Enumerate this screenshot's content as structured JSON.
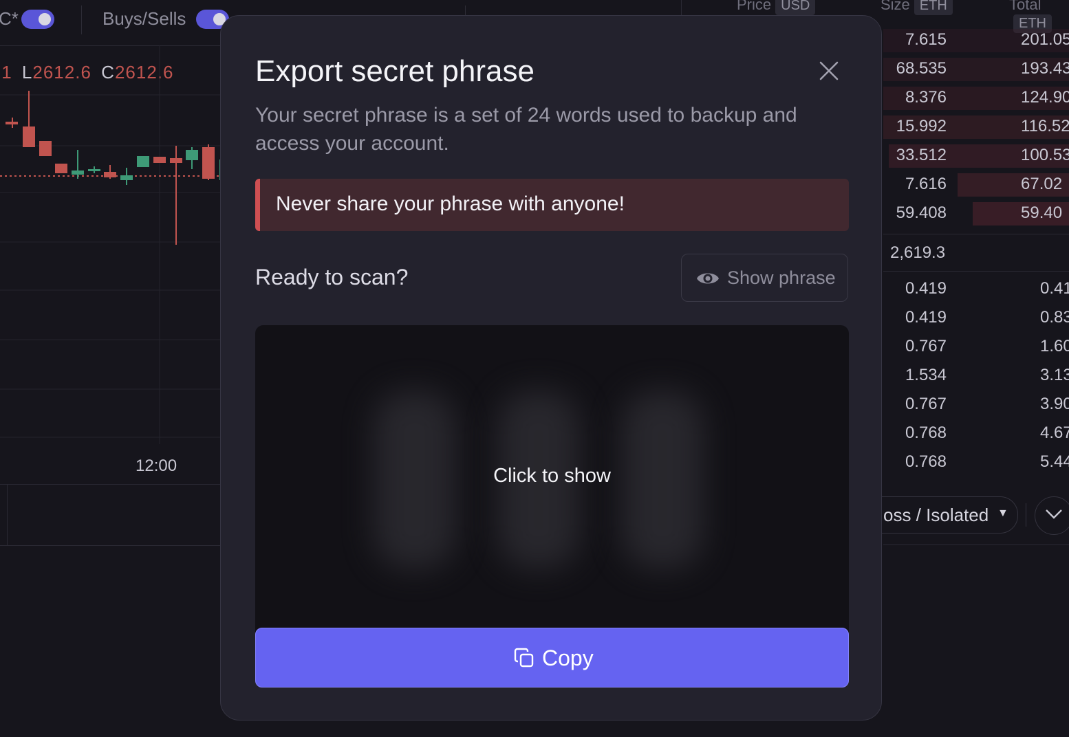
{
  "toolbar": {
    "toggle1_label": "C*",
    "toggle2_label": "Buys/Sells"
  },
  "ohlc": {
    "o_value": ".1",
    "l_key": "L",
    "l_value": "2612.6",
    "c_key": "C",
    "c_value": "2612.6"
  },
  "chart": {
    "time_label": "12:00"
  },
  "orderbook": {
    "price_header": "Price",
    "price_unit": "USD",
    "size_header": "Size",
    "size_unit": "ETH",
    "total_header": "Total",
    "total_unit": "ETH",
    "asks": [
      {
        "size": "7.615",
        "total": "201.05"
      },
      {
        "size": "68.535",
        "total": "193.43"
      },
      {
        "size": "8.376",
        "total": "124.90"
      },
      {
        "size": "15.992",
        "total": "116.52"
      },
      {
        "size": "33.512",
        "total": "100.53"
      },
      {
        "size": "7.616",
        "total": "67.02"
      },
      {
        "size": "59.408",
        "total": "59.40"
      }
    ],
    "mid_price": "2,619.3",
    "bids": [
      {
        "size": "0.419",
        "total": "0.41"
      },
      {
        "size": "0.419",
        "total": "0.83"
      },
      {
        "size": "0.767",
        "total": "1.60"
      },
      {
        "size": "1.534",
        "total": "3.13"
      },
      {
        "size": "0.767",
        "total": "3.90"
      },
      {
        "size": "0.768",
        "total": "4.67"
      },
      {
        "size": "0.768",
        "total": "5.44"
      }
    ],
    "margin_mode": "oss / Isolated"
  },
  "modal": {
    "title": "Export secret phrase",
    "description": "Your secret phrase is a set of 24 words used to backup and access your account.",
    "warning": "Never share your phrase with anyone!",
    "scan_label": "Ready to scan?",
    "show_phrase_label": "Show phrase",
    "qr_overlay_label": "Click to show",
    "copy_label": "Copy"
  },
  "colors": {
    "accent": "#6563f1",
    "warning_bg": "#41282f",
    "warning_stripe": "#cf4f52",
    "down": "#c1544f",
    "up": "#3e9a77"
  }
}
